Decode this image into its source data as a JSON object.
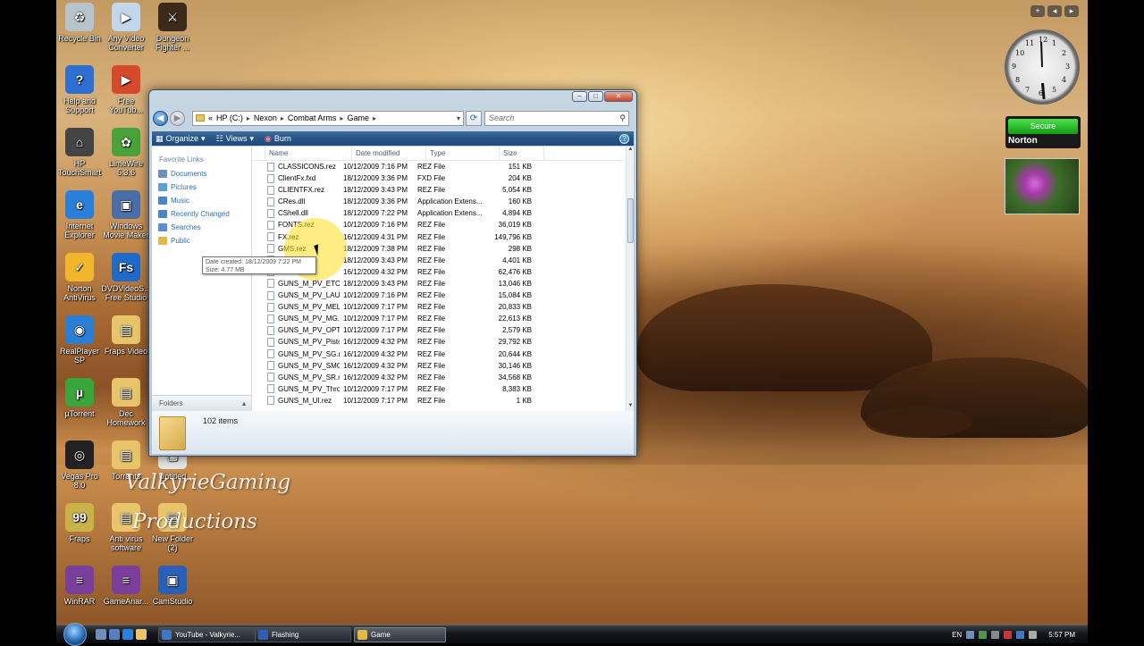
{
  "desktop": {
    "icons": [
      {
        "label": "Recycle Bin",
        "color": "#b8c4cc",
        "glyph": "♻"
      },
      {
        "label": "Any Video Converter",
        "color": "#c2d6ec",
        "glyph": "▶"
      },
      {
        "label": "Dungeon Fighter ...",
        "color": "#3b2a1a",
        "glyph": "⚔"
      },
      {
        "label": "Help and Support",
        "color": "#2f6fd1",
        "glyph": "?"
      },
      {
        "label": "Free YouTub...",
        "color": "#d64a2c",
        "glyph": "▶"
      },
      {
        "label": "HP TouchSmart",
        "color": "#444444",
        "glyph": "⌂"
      },
      {
        "label": "LimeWire 5.3.6",
        "color": "#49a23a",
        "glyph": "✿"
      },
      {
        "label": "Internet Explorer",
        "color": "#2a80d8",
        "glyph": "e"
      },
      {
        "label": "Windows Movie Maker",
        "color": "#4a6fa8",
        "glyph": "▣"
      },
      {
        "label": "Norton AntiVirus",
        "color": "#f0b62c",
        "glyph": "✓"
      },
      {
        "label": "DVDVideoS... Free Studio",
        "color": "#1f6bc9",
        "glyph": "Fs"
      },
      {
        "label": "RealPlayer SP",
        "color": "#2a7fd4",
        "glyph": "◉"
      },
      {
        "label": "Fraps Video",
        "color": "#e8c56a",
        "glyph": "▤"
      },
      {
        "label": "µTorrent",
        "color": "#3aa53a",
        "glyph": "µ"
      },
      {
        "label": "Dec Homework",
        "color": "#e8c56a",
        "glyph": "▤"
      },
      {
        "label": "Vegas Pro 8.0",
        "color": "#222222",
        "glyph": "◎"
      },
      {
        "label": "Torrents",
        "color": "#e8c56a",
        "glyph": "▤"
      },
      {
        "label": "Untitled",
        "color": "#e6e6e6",
        "glyph": "▢"
      },
      {
        "label": "Fraps",
        "color": "#c9b24a",
        "glyph": "99"
      },
      {
        "label": "Anti virus software",
        "color": "#e8c56a",
        "glyph": "▤"
      },
      {
        "label": "New Folder (2)",
        "color": "#e8c56a",
        "glyph": "▤"
      },
      {
        "label": "WinRAR",
        "color": "#7a3f9a",
        "glyph": "≡"
      },
      {
        "label": "GameAnar...",
        "color": "#7a3f9a",
        "glyph": "≡"
      },
      {
        "label": "CamStudio",
        "color": "#2a5fb8",
        "glyph": "▣"
      }
    ],
    "watermark_line1": "ValkyrieGaming",
    "watermark_line2": "Productions"
  },
  "explorer": {
    "address": {
      "overflow": "«",
      "crumbs": [
        "HP (C:)",
        "Nexon",
        "Combat Arms",
        "Game"
      ]
    },
    "search_placeholder": "Search",
    "toolbar": {
      "organize": "Organize",
      "views": "Views",
      "burn": "Burn"
    },
    "nav": {
      "header": "Favorite Links",
      "links": [
        {
          "label": "Documents",
          "color": "#6b8fbf"
        },
        {
          "label": "Pictures",
          "color": "#5e9ed6"
        },
        {
          "label": "Music",
          "color": "#4a86c9"
        },
        {
          "label": "Recently Changed",
          "color": "#4f84c4"
        },
        {
          "label": "Searches",
          "color": "#5a8fcf"
        },
        {
          "label": "Public",
          "color": "#e3b84a"
        }
      ],
      "folders_label": "Folders"
    },
    "columns": {
      "name": "Name",
      "date": "Date modified",
      "type": "Type",
      "size": "Size"
    },
    "files": [
      {
        "name": "CLASSICONS.rez",
        "date": "10/12/2009 7:16 PM",
        "type": "REZ File",
        "size": "151 KB"
      },
      {
        "name": "ClientFx.fxd",
        "date": "18/12/2009 3:36 PM",
        "type": "FXD File",
        "size": "204 KB"
      },
      {
        "name": "CLIENTFX.rez",
        "date": "18/12/2009 3:43 PM",
        "type": "REZ File",
        "size": "5,054 KB"
      },
      {
        "name": "CRes.dll",
        "date": "18/12/2009 3:36 PM",
        "type": "Application Extens...",
        "size": "160 KB"
      },
      {
        "name": "CShell.dll",
        "date": "18/12/2009 7:22 PM",
        "type": "Application Extens...",
        "size": "4,894 KB"
      },
      {
        "name": "FONTS.rez",
        "date": "10/12/2009 7:16 PM",
        "type": "REZ File",
        "size": "36,019 KB"
      },
      {
        "name": "FX.rez",
        "date": "16/12/2009 4:31 PM",
        "type": "REZ File",
        "size": "149,796 KB"
      },
      {
        "name": "GMS.rez",
        "date": "18/12/2009 7:38 PM",
        "type": "REZ File",
        "size": "298 KB"
      },
      {
        "name": "...H.rez",
        "date": "18/12/2009 3:43 PM",
        "type": "REZ File",
        "size": "4,401 KB"
      },
      {
        "name": "...AR.rez",
        "date": "16/12/2009 4:32 PM",
        "type": "REZ File",
        "size": "62,476 KB"
      },
      {
        "name": "GUNS_M_PV_ETC.rez",
        "date": "18/12/2009 3:43 PM",
        "type": "REZ File",
        "size": "13,046 KB"
      },
      {
        "name": "GUNS_M_PV_LAUN...",
        "date": "10/12/2009 7:16 PM",
        "type": "REZ File",
        "size": "15,084 KB"
      },
      {
        "name": "GUNS_M_PV_MELE...",
        "date": "10/12/2009 7:17 PM",
        "type": "REZ File",
        "size": "20,833 KB"
      },
      {
        "name": "GUNS_M_PV_MG.rez",
        "date": "10/12/2009 7:17 PM",
        "type": "REZ File",
        "size": "22,613 KB"
      },
      {
        "name": "GUNS_M_PV_OPTI...",
        "date": "10/12/2009 7:17 PM",
        "type": "REZ File",
        "size": "2,579 KB"
      },
      {
        "name": "GUNS_M_PV_Pistol...",
        "date": "16/12/2009 4:32 PM",
        "type": "REZ File",
        "size": "29,792 KB"
      },
      {
        "name": "GUNS_M_PV_SG.rez",
        "date": "16/12/2009 4:32 PM",
        "type": "REZ File",
        "size": "20,644 KB"
      },
      {
        "name": "GUNS_M_PV_SMG.rez",
        "date": "16/12/2009 4:32 PM",
        "type": "REZ File",
        "size": "30,146 KB"
      },
      {
        "name": "GUNS_M_PV_SR.rez",
        "date": "16/12/2009 4:32 PM",
        "type": "REZ File",
        "size": "34,568 KB"
      },
      {
        "name": "GUNS_M_PV_Throw...",
        "date": "10/12/2009 7:17 PM",
        "type": "REZ File",
        "size": "8,383 KB"
      },
      {
        "name": "GUNS_M_UI.rez",
        "date": "10/12/2009 7:17 PM",
        "type": "REZ File",
        "size": "1 KB"
      }
    ],
    "tooltip": {
      "line1": "Date created: 18/12/2009 7:22 PM",
      "line2": "Size: 4.77 MB"
    },
    "item_count": "102 items"
  },
  "gadgets": {
    "norton_status": "Secure",
    "norton_brand": "Norton",
    "clock_numbers": [
      "12",
      "1",
      "2",
      "3",
      "4",
      "5",
      "6",
      "7",
      "8",
      "9",
      "10",
      "11"
    ]
  },
  "taskbar": {
    "buttons": [
      {
        "label": "YouTube - Valkyrie...",
        "color": "#3a78c8"
      },
      {
        "label": "Flashing",
        "color": "#2f5fb8"
      },
      {
        "label": "Game",
        "color": "#e3b84a"
      }
    ],
    "language": "EN",
    "time": "5:57 PM"
  }
}
